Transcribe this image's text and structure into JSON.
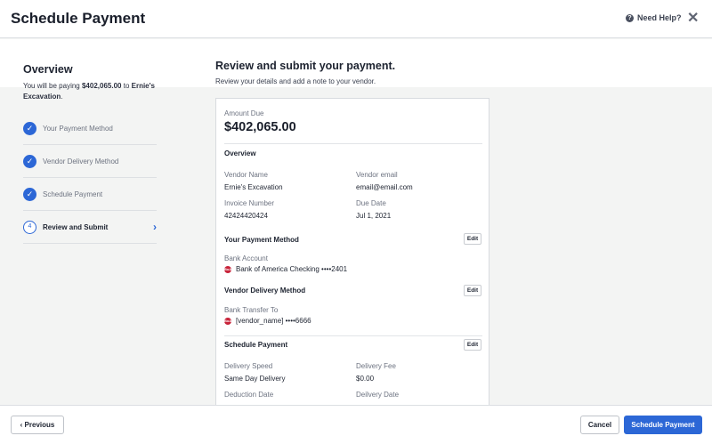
{
  "header": {
    "title": "Schedule Payment",
    "help_label": "Need Help?",
    "close_glyph": "✕"
  },
  "sidebar": {
    "title": "Overview",
    "summary_prefix": "You will be paying",
    "summary_amount": "$402,065.00",
    "summary_to": "to",
    "summary_vendor": "Ernie's Excavation",
    "summary_end": ".",
    "steps": [
      {
        "label": "Your Payment Method",
        "status": "complete"
      },
      {
        "label": "Vendor Delivery Method",
        "status": "complete"
      },
      {
        "label": "Schedule Payment",
        "status": "complete"
      },
      {
        "label": "Review and Submit",
        "status": "active",
        "number": "4"
      }
    ]
  },
  "main": {
    "title": "Review and submit your payment.",
    "subtitle": "Review your details and add a note to your vendor.",
    "card": {
      "amount_due_label": "Amount Due",
      "amount_due": "$402,065.00",
      "overview_heading": "Overview",
      "vendor_name_label": "Vendor Name",
      "vendor_name": "Ernie's Excavation",
      "vendor_email_label": "Vendor email",
      "vendor_email": "email@email.com",
      "invoice_number_label": "Invoice Number",
      "invoice_number": "42424420424",
      "due_date_label": "Due Date",
      "due_date": "Jul 1, 2021",
      "payment_method_heading": "Your Payment Method",
      "bank_account_label": "Bank Account",
      "bank_account_value": "Bank of America Checking ••••2401",
      "delivery_method_heading": "Vendor Delivery Method",
      "bank_transfer_label": "Bank Transfer To",
      "bank_transfer_value": "[vendor_name] ••••6666",
      "schedule_heading": "Schedule Payment",
      "delivery_speed_label": "Delivery Speed",
      "delivery_speed": "Same Day Delivery",
      "delivery_fee_label": "Delivery Fee",
      "delivery_fee": "$0.00",
      "deduction_date_label": "Deduction Date",
      "delivery_date_label": "Deilvery Date",
      "edit_label": "Edit",
      "bank_icon_text": "BoA"
    }
  },
  "footer": {
    "previous_label": "Previous",
    "previous_glyph": "‹",
    "cancel_label": "Cancel",
    "submit_label": "Schedule Payment"
  },
  "colors": {
    "accent": "#2c67d6",
    "bank_icon": "#c8233a",
    "background": "#f3f4f3"
  }
}
